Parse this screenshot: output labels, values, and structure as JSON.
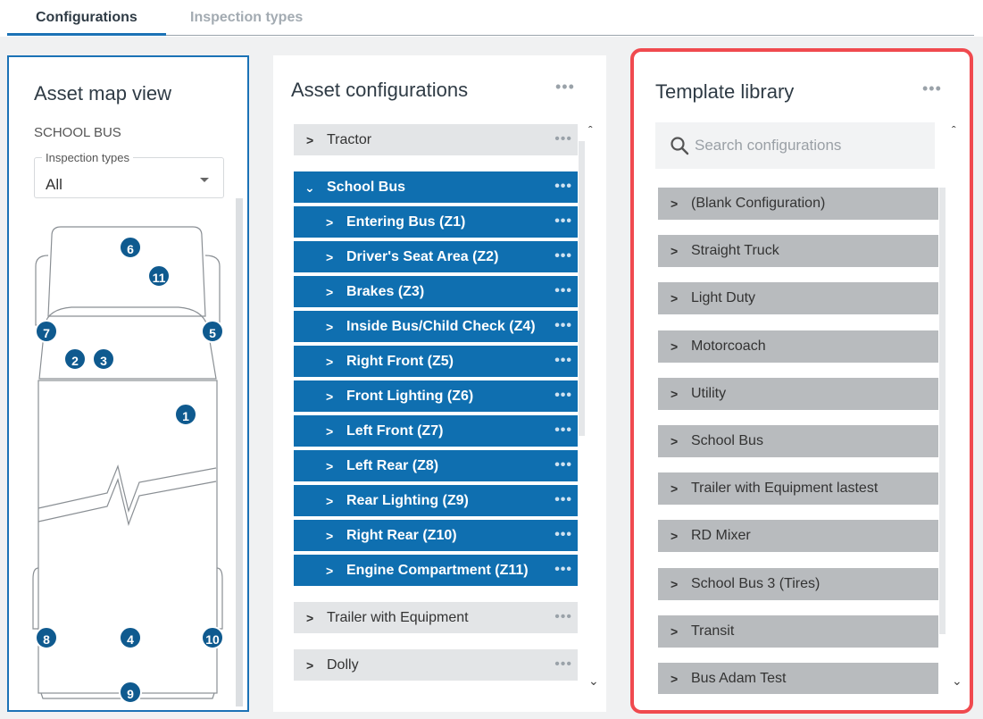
{
  "tabs": [
    {
      "label": "Configurations",
      "active": true
    },
    {
      "label": "Inspection types",
      "active": false
    }
  ],
  "asset_map": {
    "title": "Asset map view",
    "asset_name": "SCHOOL BUS",
    "inspection_types": {
      "label": "Inspection types",
      "value": "All"
    },
    "zones": [
      "1",
      "2",
      "3",
      "4",
      "5",
      "6",
      "7",
      "8",
      "9",
      "10",
      "11"
    ]
  },
  "asset_configurations": {
    "title": "Asset configurations",
    "items": [
      {
        "label": "Tractor",
        "state": "collapsed"
      },
      {
        "label": "School Bus",
        "state": "expanded",
        "children": [
          "Entering Bus (Z1)",
          "Driver's Seat Area (Z2)",
          "Brakes (Z3)",
          "Inside Bus/Child Check (Z4)",
          "Right Front (Z5)",
          "Front Lighting (Z6)",
          "Left Front (Z7)",
          "Left Rear (Z8)",
          "Rear Lighting (Z9)",
          "Right Rear (Z10)",
          "Engine Compartment (Z11)"
        ]
      },
      {
        "label": "Trailer with Equipment",
        "state": "collapsed"
      },
      {
        "label": "Dolly",
        "state": "collapsed"
      }
    ]
  },
  "template_library": {
    "title": "Template library",
    "search_placeholder": "Search configurations",
    "items": [
      "(Blank Configuration)",
      "Straight Truck",
      "Light Duty",
      "Motorcoach",
      "Utility",
      "School Bus",
      "Trailer with Equipment lastest",
      "RD Mixer",
      "School Bus 3 (Tires)",
      "Transit",
      "Bus Adam Test"
    ]
  },
  "colors": {
    "accent": "#1b72b6",
    "expanded_row": "#0f6fb0",
    "zone_marker": "#0f5a8f",
    "highlight_border": "#f04a4f"
  },
  "icons": {
    "more": "more-horizontal-icon",
    "expand": "chevron-right-icon",
    "collapse": "chevron-down-icon",
    "search": "search-icon",
    "dropdown": "caret-down-icon",
    "scroll_up": "chevron-up-icon",
    "scroll_down": "chevron-down-icon"
  }
}
